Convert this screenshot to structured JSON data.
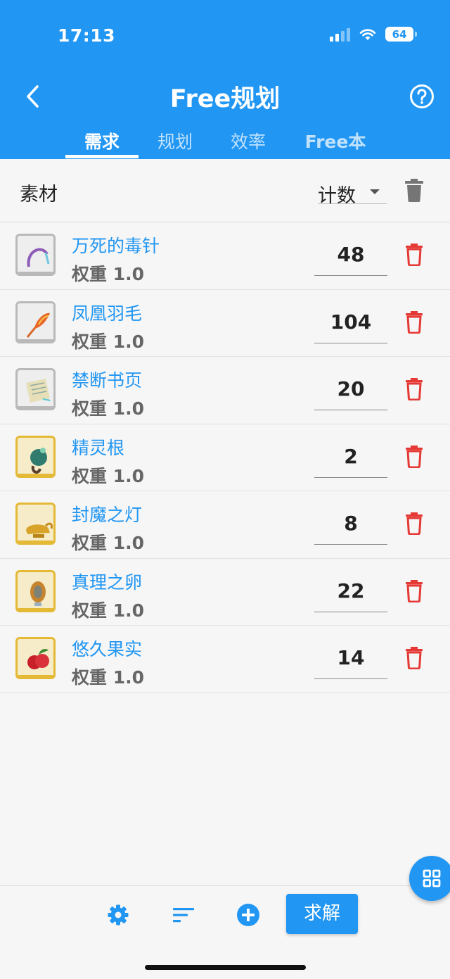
{
  "status_bar": {
    "time": "17:13",
    "battery": "64"
  },
  "app_bar": {
    "title": "Free规划"
  },
  "tabs": [
    {
      "label": "需求",
      "active": true
    },
    {
      "label": "规划",
      "active": false
    },
    {
      "label": "效率",
      "active": false
    },
    {
      "label": "Free本",
      "active": false
    }
  ],
  "list_header": {
    "label": "素材",
    "sort_value": "计数"
  },
  "items": [
    {
      "name": "万死的毒针",
      "weight": "权重 1.0",
      "count": "48",
      "frame": "silver"
    },
    {
      "name": "凤凰羽毛",
      "weight": "权重 1.0",
      "count": "104",
      "frame": "silver"
    },
    {
      "name": "禁断书页",
      "weight": "权重 1.0",
      "count": "20",
      "frame": "silver"
    },
    {
      "name": "精灵根",
      "weight": "权重 1.0",
      "count": "2",
      "frame": "gold"
    },
    {
      "name": "封魔之灯",
      "weight": "权重 1.0",
      "count": "8",
      "frame": "gold"
    },
    {
      "name": "真理之卵",
      "weight": "权重 1.0",
      "count": "22",
      "frame": "gold"
    },
    {
      "name": "悠久果实",
      "weight": "权重 1.0",
      "count": "14",
      "frame": "gold"
    }
  ],
  "bottom_bar": {
    "solve_label": "求解"
  },
  "colors": {
    "primary": "#2196f3",
    "delete": "#e53935",
    "silver_frame": "#b9b9b9",
    "gold_frame": "#e3b935"
  },
  "icons": [
    "back-arrow-icon",
    "help-icon",
    "trash-icon",
    "settings-icon",
    "sort-icon",
    "add-circle-icon",
    "grid-icon"
  ]
}
